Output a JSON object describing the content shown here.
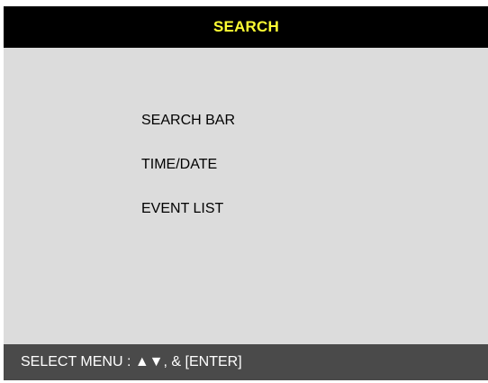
{
  "header": {
    "title": "SEARCH"
  },
  "menu": {
    "items": [
      {
        "label": "SEARCH BAR"
      },
      {
        "label": "TIME/DATE"
      },
      {
        "label": "EVENT LIST"
      }
    ]
  },
  "footer": {
    "instruction": "SELECT MENU : ▲▼, & [ENTER]"
  },
  "colors": {
    "header_bg": "#000000",
    "title_text": "#ffff33",
    "panel_bg": "#dcdcdc",
    "footer_bg": "#4a4a4a",
    "footer_text": "#ffffff"
  }
}
